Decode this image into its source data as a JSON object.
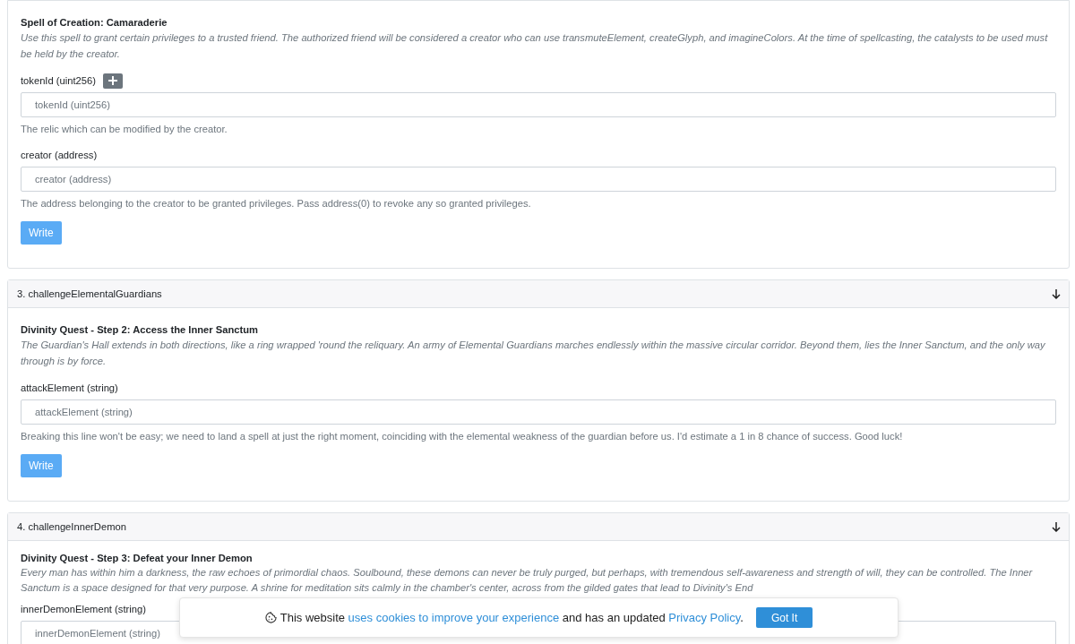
{
  "sections": [
    {
      "title": "Spell of Creation: Camaraderie",
      "description": "Use this spell to grant certain privileges to a trusted friend. The authorized friend will be considered a creator who can use transmuteElement, createGlyph, and imagineColors. At the time of spellcasting, the catalysts to be used must be held by the creator.",
      "fields": [
        {
          "label": "tokenId (uint256)",
          "add_button": true,
          "placeholder": "tokenId (uint256)",
          "help": "The relic which can be modified by the creator."
        },
        {
          "label": "creator (address)",
          "add_button": false,
          "placeholder": "creator (address)",
          "help": "The address belonging to the creator to be granted privileges. Pass address(0) to revoke any so granted privileges."
        }
      ],
      "button": "Write"
    },
    {
      "header": "3. challengeElementalGuardians",
      "title": "Divinity Quest - Step 2: Access the Inner Sanctum",
      "description": "The Guardian's Hall extends in both directions, like a ring wrapped 'round the reliquary. An army of Elemental Guardians marches endlessly within the massive circular corridor. Beyond them, lies the Inner Sanctum, and the only way through is by force.",
      "fields": [
        {
          "label": "attackElement (string)",
          "add_button": false,
          "placeholder": "attackElement (string)",
          "help": "Breaking this line won't be easy; we need to land a spell at just the right moment, coinciding with the elemental weakness of the guardian before us. I'd estimate a 1 in 8 chance of success. Good luck!"
        }
      ],
      "button": "Write"
    },
    {
      "header": "4. challengeInnerDemon",
      "title": "Divinity Quest - Step 3: Defeat your Inner Demon",
      "description": "Every man has within him a darkness, the raw echoes of primordial chaos. Soulbound, these demons can never be truly purged, but perhaps, with tremendous self-awareness and strength of will, they can be controlled. The Inner Sanctum is a space designed for that very purpose. A shrine for meditation sits calmly in the chamber's center, across from the gilded gates that lead to Divinity's End",
      "fields": [
        {
          "label": "innerDemonElement (string)",
          "add_button": false,
          "placeholder": "innerDemonElement (string)"
        }
      ]
    }
  ],
  "cookie_banner": {
    "parts": [
      {
        "kind": "text",
        "text": "This website"
      },
      {
        "kind": "link",
        "text": "uses cookies to improve your experience"
      },
      {
        "kind": "text",
        "text": "and has an updated"
      },
      {
        "kind": "link",
        "text": "Privacy Policy"
      },
      {
        "kind": "text",
        "text": "."
      }
    ],
    "button": "Got It"
  }
}
